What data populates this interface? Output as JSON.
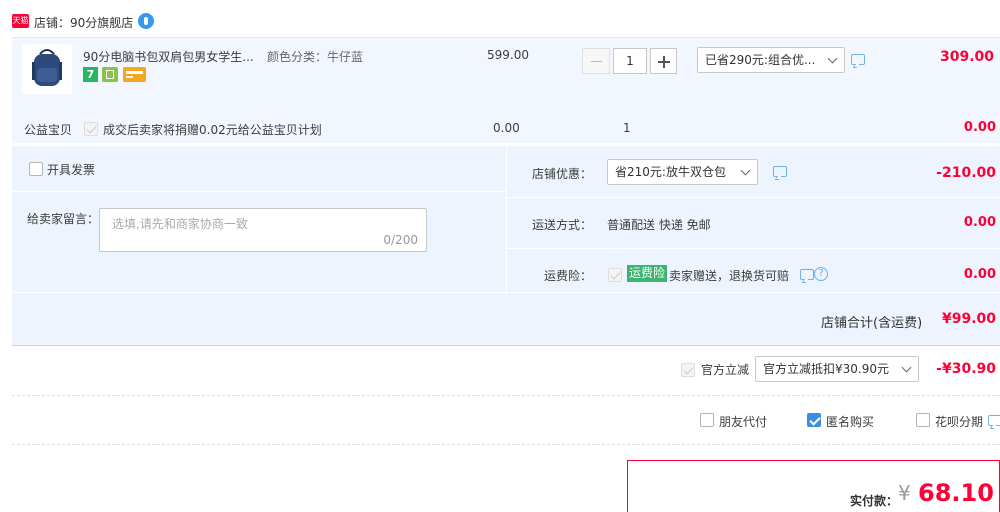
{
  "store": {
    "badge": "天猫",
    "name": "店铺：90分旗舰店"
  },
  "product": {
    "title": "90分电脑书包双肩包男女学生...",
    "spec": "颜色分类：牛仔蓝",
    "unit_price": "599.00",
    "quantity": "1",
    "promo": "已省290元:组合优...",
    "subtotal": "309.00",
    "badge_7": "7"
  },
  "charity": {
    "label": "公益宝贝",
    "text": "成交后卖家将捐赠0.02元给公益宝贝计划",
    "price": "0.00",
    "qty": "1",
    "amount": "0.00"
  },
  "invoice": {
    "label": "开具发票"
  },
  "message": {
    "label": "给卖家留言：",
    "placeholder": "选填,请先和商家协商一致",
    "counter": "0/200"
  },
  "shop_discount": {
    "label": "店铺优惠：",
    "value": "省210元:放牛双仓包",
    "amount": "-210.00"
  },
  "shipping": {
    "label": "运送方式：",
    "value": "普通配送 快递 免邮",
    "amount": "0.00"
  },
  "insurance": {
    "label": "运费险：",
    "tag": "运费险",
    "text": "卖家赠送，退换货可赔",
    "amount": "0.00"
  },
  "store_total": {
    "label": "店铺合计(含运费)",
    "amount": "¥99.00"
  },
  "official": {
    "label": "官方立减",
    "value": "官方立减抵扣¥30.90元",
    "amount": "-¥30.90"
  },
  "options": {
    "friend_pay": "朋友代付",
    "anonymous": "匿名购买",
    "installment": "花呗分期"
  },
  "final": {
    "label": "实付款：",
    "currency": "¥",
    "amount": "68.10"
  }
}
